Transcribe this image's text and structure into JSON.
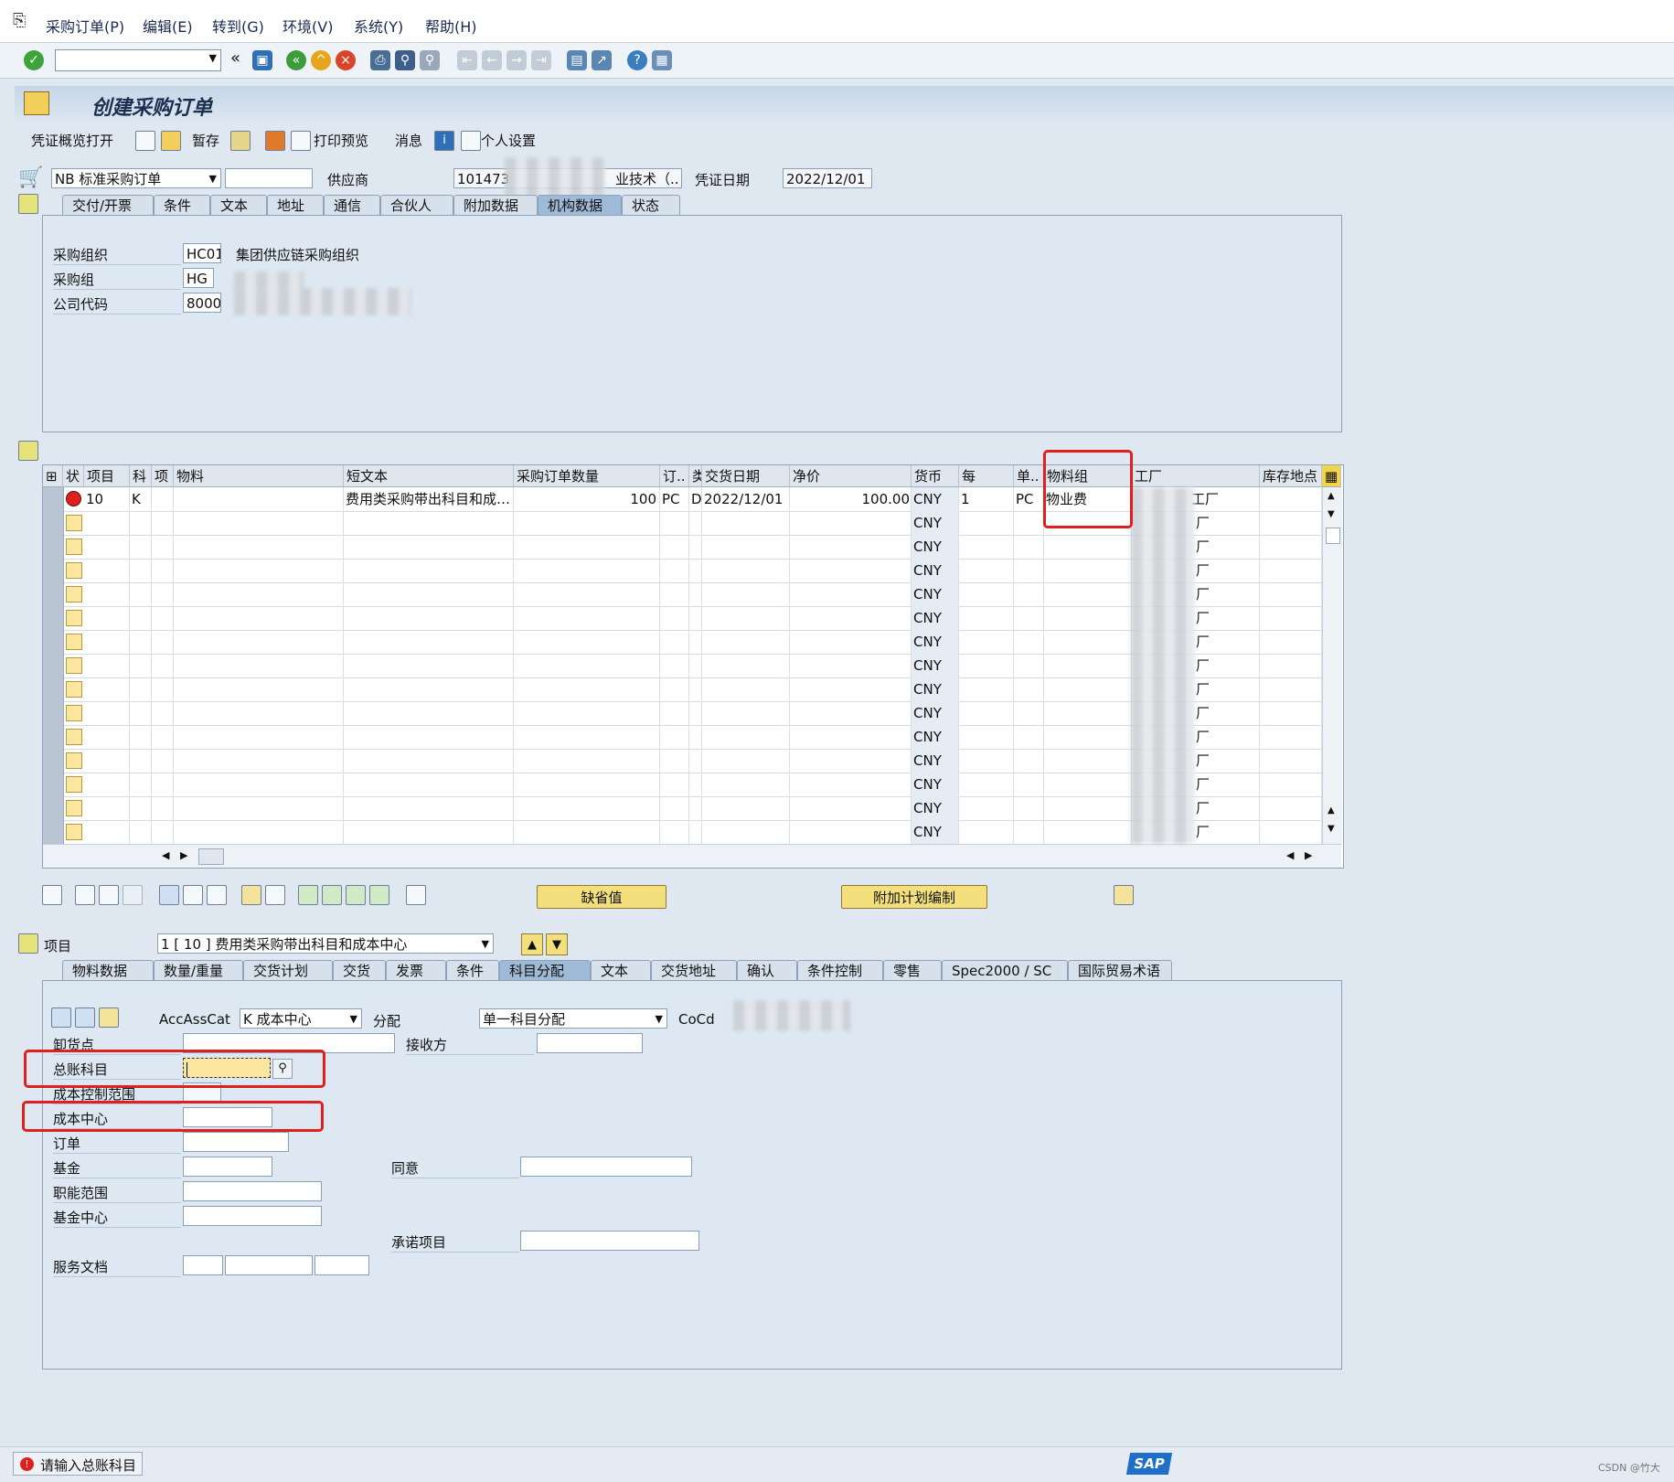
{
  "menu": [
    "采购订单(P)",
    "编辑(E)",
    "转到(G)",
    "环境(V)",
    "系统(Y)",
    "帮助(H)"
  ],
  "title": "创建采购订单",
  "app_toolbar": {
    "doc_overview": "凭证概览打开",
    "hold": "暂存",
    "print_preview": "打印预览",
    "messages": "消息",
    "personal_settings": "个人设置"
  },
  "header": {
    "order_type": "NB 标准采购订单",
    "vendor_label": "供应商",
    "vendor_value": "101473",
    "vendor_name_fragment": "业技术（..",
    "doc_date_label": "凭证日期",
    "doc_date": "2022/12/01"
  },
  "header_tabs": [
    "交付/开票",
    "条件",
    "文本",
    "地址",
    "通信",
    "合伙人",
    "附加数据",
    "机构数据",
    "状态"
  ],
  "org_data": {
    "purch_org_label": "采购组织",
    "purch_org": "HC01",
    "purch_org_name": "集团供应链采购组织",
    "purch_group_label": "采购组",
    "purch_group": "HG",
    "company_code_label": "公司代码",
    "company_code": "8000"
  },
  "items_grid": {
    "columns": [
      "状",
      "项目",
      "科",
      "项",
      "物料",
      "短文本",
      "采购订单数量",
      "订..",
      "类",
      "交货日期",
      "净价",
      "货币",
      "每",
      "单..",
      "物料组",
      "工厂",
      "库存地点"
    ],
    "row": {
      "item": "10",
      "acct": "K",
      "short_text": "费用类采购带出科目和成…",
      "qty": "100",
      "unit": "PC",
      "date_cat": "D",
      "delivery_date": "2022/12/01",
      "net_price": "100.00",
      "currency": "CNY",
      "per": "1",
      "order_unit": "PC",
      "material_group": "物业费",
      "plant_suffix": "工厂"
    },
    "empty_currency": "CNY",
    "empty_plant_suffix": "厂"
  },
  "buttons": {
    "default_values": "缺省值",
    "addl_planning": "附加计划编制"
  },
  "item_detail": {
    "item_label": "项目",
    "item_selector": "1 [ 10 ] 费用类采购带出科目和成本中心",
    "tabs": [
      "物料数据",
      "数量/重量",
      "交货计划",
      "交货",
      "发票",
      "条件",
      "科目分配",
      "文本",
      "交货地址",
      "确认",
      "条件控制",
      "零售",
      "Spec2000 / SC",
      "国际贸易术语"
    ],
    "acc_ass_cat_label": "AccAssCat",
    "acc_ass_cat_value": "K 成本中心",
    "distribution_label": "分配",
    "distribution_value": "单一科目分配",
    "cocd_label": "CoCd",
    "unloading_point": "卸货点",
    "recipient": "接收方",
    "gl_account": "总账科目",
    "co_area": "成本控制范围",
    "cost_center": "成本中心",
    "order": "订单",
    "fund": "基金",
    "agreement": "同意",
    "functional_area": "职能范围",
    "fund_center": "基金中心",
    "commitment_item": "承诺项目",
    "service_doc": "服务文档"
  },
  "status": {
    "message": "请输入总账科目",
    "watermark": "CSDN @竹大"
  },
  "colors": {
    "error_red": "#e0201e",
    "button_yellow": "#f4df7d",
    "panel_blue": "#dde8f3"
  }
}
